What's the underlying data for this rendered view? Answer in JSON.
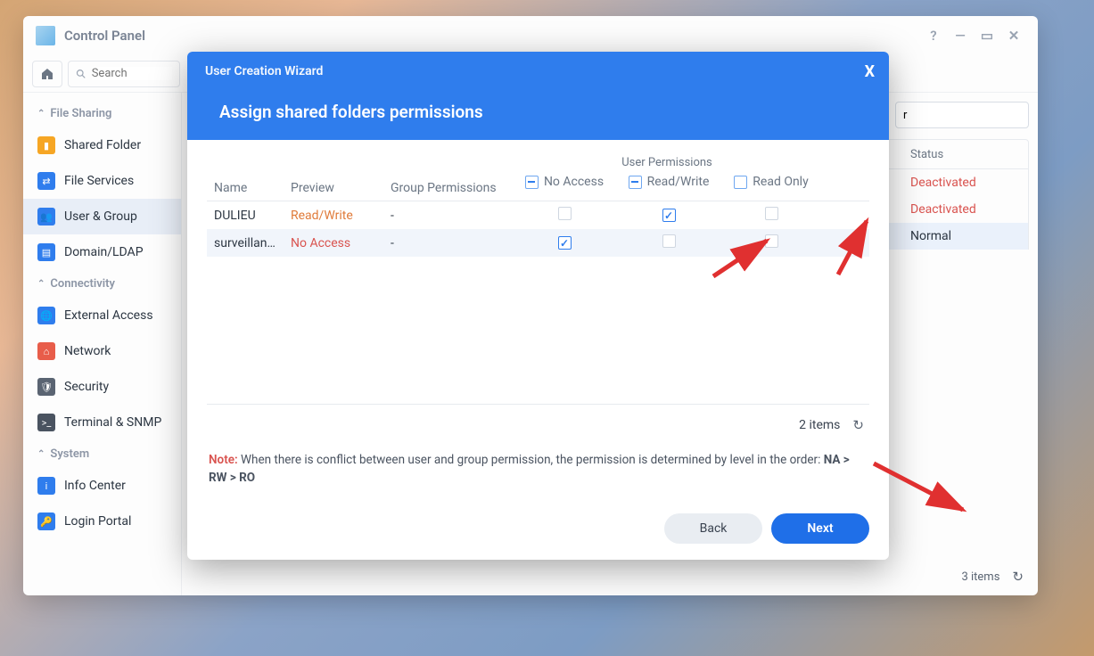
{
  "window": {
    "title": "Control Panel"
  },
  "toolbar": {
    "search_placeholder": "Search"
  },
  "sidebar": {
    "groups": {
      "file_sharing": "File Sharing",
      "connectivity": "Connectivity",
      "system": "System"
    },
    "items": {
      "shared_folder": "Shared Folder",
      "file_services": "File Services",
      "user_group": "User & Group",
      "domain_ldap": "Domain/LDAP",
      "external_access": "External Access",
      "network": "Network",
      "security": "Security",
      "terminal_snmp": "Terminal & SNMP",
      "info_center": "Info Center",
      "login_portal": "Login Portal"
    }
  },
  "main_table": {
    "filter_placeholder": "r",
    "headers": {
      "status": "Status"
    },
    "rows": [
      {
        "status": "Deactivated",
        "deactivated": true
      },
      {
        "status": "Deactivated",
        "deactivated": true
      },
      {
        "status": "Normal",
        "deactivated": false
      }
    ],
    "item_count": "3 items"
  },
  "modal": {
    "wizard_title": "User Creation Wizard",
    "page_title": "Assign shared folders permissions",
    "columns": {
      "name": "Name",
      "preview": "Preview",
      "group_permissions": "Group Permissions",
      "user_permissions": "User Permissions",
      "no_access": "No Access",
      "read_write": "Read/Write",
      "read_only": "Read Only"
    },
    "header_state": {
      "no_access": "indeterminate",
      "read_write": "indeterminate",
      "read_only": "unchecked"
    },
    "folders": [
      {
        "name": "DULIEU",
        "preview": "Read/Write",
        "preview_color": "orange",
        "group": "-",
        "no_access": false,
        "read_write": true,
        "read_only": false
      },
      {
        "name": "surveillan…",
        "preview": "No Access",
        "preview_color": "red",
        "group": "-",
        "no_access": true,
        "read_write": false,
        "read_only": false
      }
    ],
    "item_count": "2 items",
    "note_label": "Note:",
    "note_text": "When there is conflict between user and group permission, the permission is determined by level in the order: ",
    "note_order": "NA > RW > RO",
    "buttons": {
      "back": "Back",
      "next": "Next"
    }
  }
}
